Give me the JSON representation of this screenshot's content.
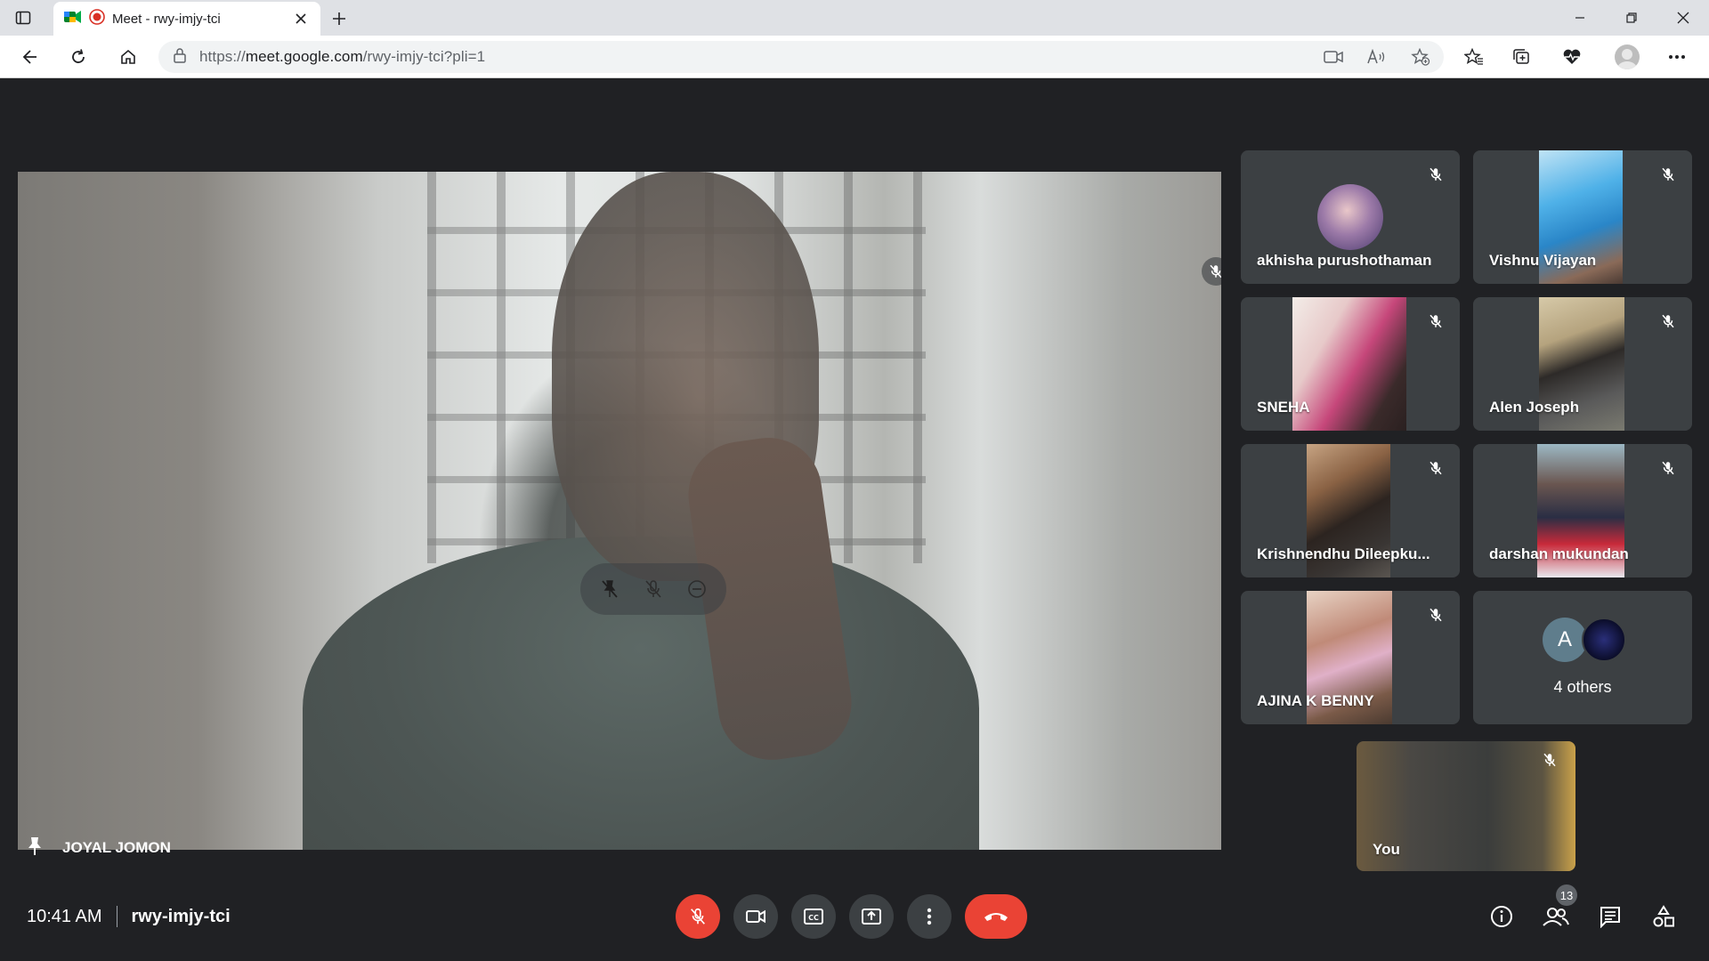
{
  "browser": {
    "tab_title": "Meet - rwy-imjy-tci",
    "url_prefix": "https://",
    "url_host": "meet.google.com",
    "url_path": "/rwy-imjy-tci?pli=1"
  },
  "main_speaker": {
    "name": "JOYAL JOMON"
  },
  "participants": [
    {
      "name": "akhisha purushothaman"
    },
    {
      "name": "Vishnu Vijayan"
    },
    {
      "name": "SNEHA"
    },
    {
      "name": "Alen Joseph"
    },
    {
      "name": "Krishnendhu Dileepku..."
    },
    {
      "name": "darshan mukundan"
    },
    {
      "name": "AJINA K BENNY"
    }
  ],
  "others": {
    "avatar_letter": "A",
    "label": "4 others"
  },
  "self_tile": {
    "name": "You"
  },
  "bottom_bar": {
    "time": "10:41 AM",
    "meeting_code": "rwy-imjy-tci",
    "people_count": "13"
  },
  "colors": {
    "background": "#202124",
    "tile": "#3c4043",
    "danger": "#ea4335"
  }
}
